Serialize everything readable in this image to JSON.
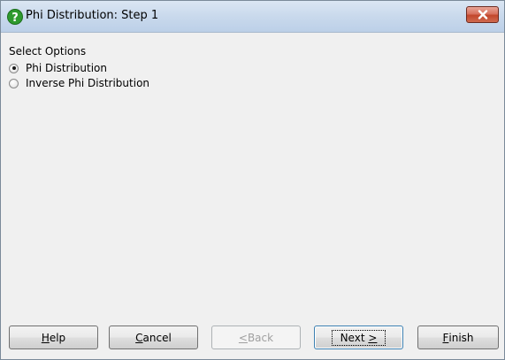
{
  "window": {
    "title": "Phi Distribution: Step 1",
    "icon": "question-help-icon"
  },
  "options": {
    "group_label": "Select Options",
    "items": [
      {
        "label": "Phi Distribution",
        "checked": true
      },
      {
        "label": "Inverse Phi Distribution",
        "checked": false
      }
    ]
  },
  "buttons": {
    "help": {
      "ul": "H",
      "rest": "elp"
    },
    "cancel": {
      "ul": "C",
      "rest": "ancel"
    },
    "back": {
      "ul": "<",
      "rest": " Back",
      "enabled": false
    },
    "next": {
      "pre": "Next ",
      "ul": ">"
    },
    "finish": {
      "ul": "F",
      "rest": "inish"
    }
  },
  "colors": {
    "titlebar": "#c9d9ec",
    "close_button": "#c2472c",
    "dialog_bg": "#f0f0f0",
    "help_icon": "#2e9a2e"
  }
}
